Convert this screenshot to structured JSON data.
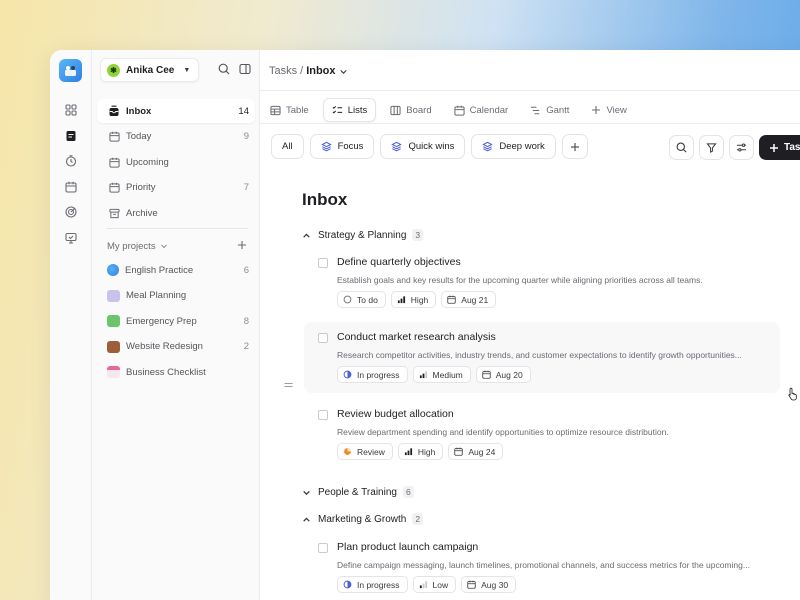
{
  "user": {
    "name": "Anika Cee"
  },
  "nav": [
    {
      "label": "Inbox",
      "count": "14",
      "icon": "inbox-icon"
    },
    {
      "label": "Today",
      "count": "9",
      "icon": "calendar-icon"
    },
    {
      "label": "Upcoming",
      "count": "",
      "icon": "calendar-icon"
    },
    {
      "label": "Priority",
      "count": "7",
      "icon": "calendar-icon"
    },
    {
      "label": "Archive",
      "count": "",
      "icon": "archive-icon"
    }
  ],
  "projects_header": "My projects",
  "projects": [
    {
      "label": "English Practice",
      "count": "6",
      "color": "#2f7fe6"
    },
    {
      "label": "Meal Planning",
      "count": "",
      "color": "#b9b2e6"
    },
    {
      "label": "Emergency Prep",
      "count": "8",
      "color": "#5cb85c"
    },
    {
      "label": "Website Redesign",
      "count": "2",
      "color": "#8a5a3c"
    },
    {
      "label": "Business Checklist",
      "count": "",
      "color": "#e88ab4"
    }
  ],
  "breadcrumb": {
    "parent": "Tasks",
    "separator": "/",
    "current": "Inbox"
  },
  "tabs": [
    {
      "label": "Table"
    },
    {
      "label": "Lists"
    },
    {
      "label": "Board"
    },
    {
      "label": "Calendar"
    },
    {
      "label": "Gantt"
    },
    {
      "label": "View"
    }
  ],
  "filters": [
    {
      "label": "All"
    },
    {
      "label": "Focus"
    },
    {
      "label": "Quick wins"
    },
    {
      "label": "Deep work"
    }
  ],
  "new_button_label": "Task",
  "page_title": "Inbox",
  "groups": [
    {
      "name": "Strategy & Planning",
      "count": "3",
      "tasks": [
        {
          "title": "Define quarterly objectives",
          "desc": "Establish goals and key results for the upcoming quarter while aligning priorities across all teams.",
          "status": "To do",
          "priority": "High",
          "date": "Aug 21"
        },
        {
          "title": "Conduct market research analysis",
          "desc": "Research competitor activities, industry trends, and customer expectations to identify growth opportunities...",
          "status": "In progress",
          "priority": "Medium",
          "date": "Aug 20"
        },
        {
          "title": "Review budget allocation",
          "desc": "Review department spending and identify opportunities to optimize resource distribution.",
          "status": "Review",
          "priority": "High",
          "date": "Aug 24"
        }
      ]
    },
    {
      "name": "People & Training",
      "count": "6",
      "tasks": []
    },
    {
      "name": "Marketing & Growth",
      "count": "2",
      "tasks": [
        {
          "title": "Plan product launch campaign",
          "desc": "Define campaign messaging, launch timelines, promotional channels, and success metrics for the upcoming...",
          "status": "In progress",
          "priority": "Low",
          "date": "Aug 30"
        }
      ]
    }
  ],
  "colors": {
    "accent": "#4b5fd8",
    "dark_button": "#1f1f23",
    "review": "#f08a24",
    "in_progress": "#4b5fd8"
  }
}
